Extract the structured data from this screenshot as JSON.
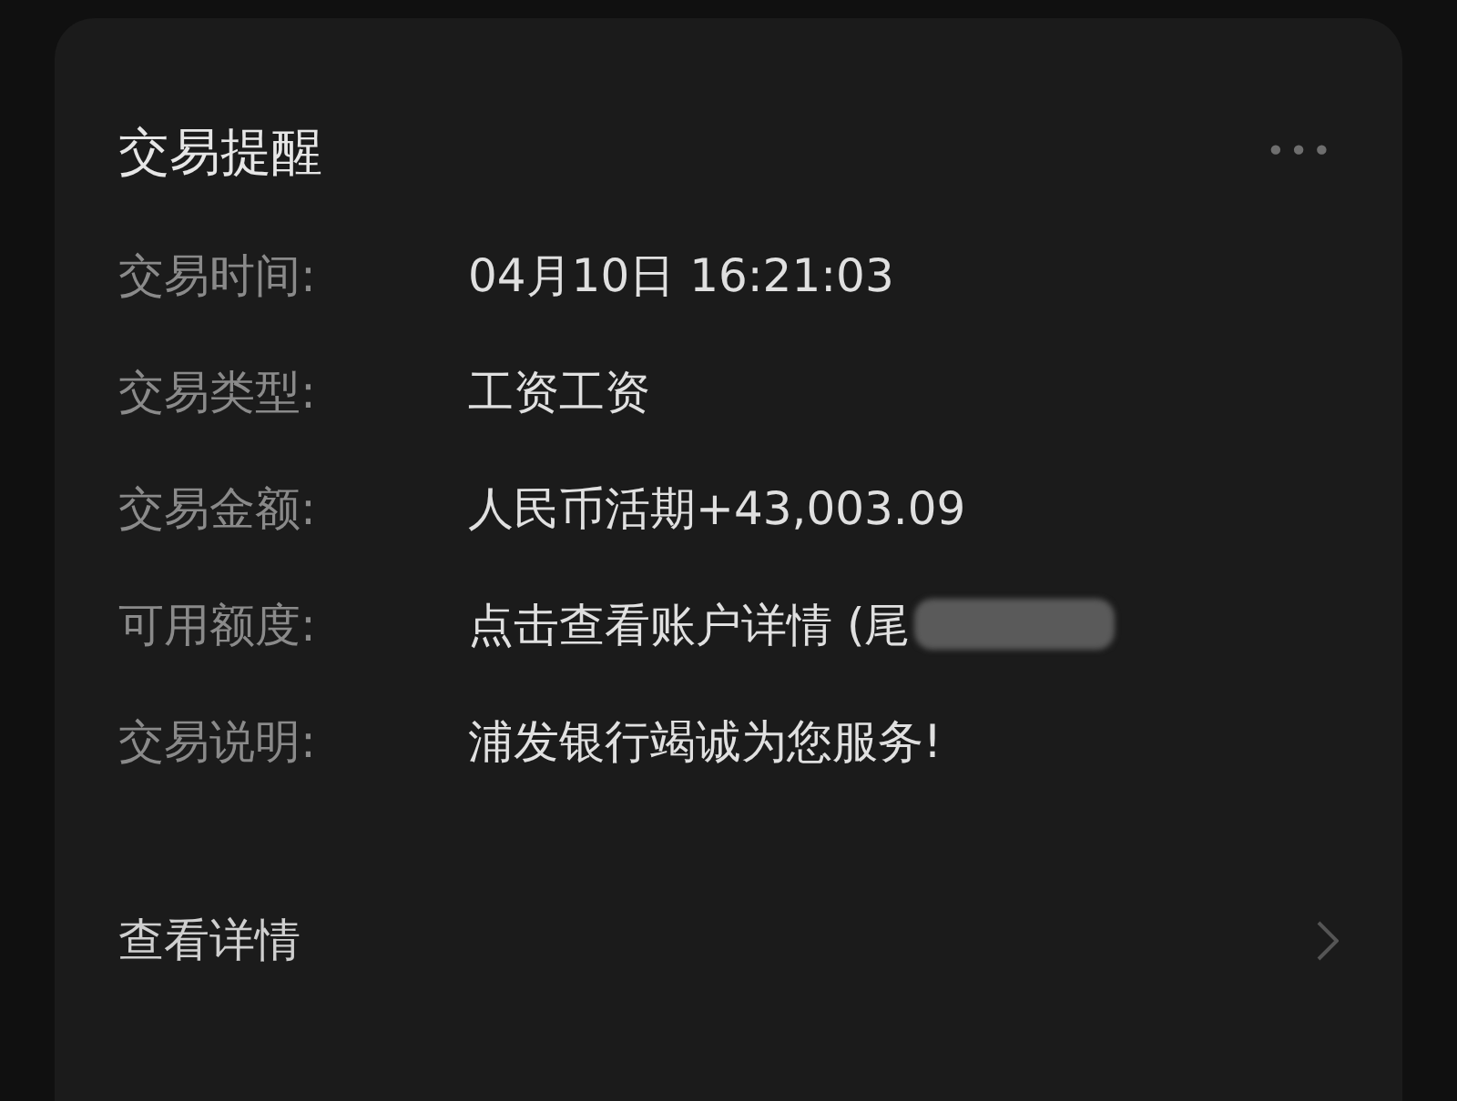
{
  "card": {
    "title": "交易提醒",
    "menu": "•••",
    "rows": [
      {
        "label": "交易时间:",
        "value": "04月10日  16:21:03"
      },
      {
        "label": "交易类型:",
        "value": "工资工资"
      },
      {
        "label": "交易金额:",
        "value": "人民币活期+43,003.09"
      },
      {
        "label": "可用额度:",
        "value": "点击查看账户详情 (尾",
        "redacted": true
      },
      {
        "label": "交易说明:",
        "value": "浦发银行竭诚为您服务!"
      }
    ],
    "footer_link": "查看详情"
  }
}
